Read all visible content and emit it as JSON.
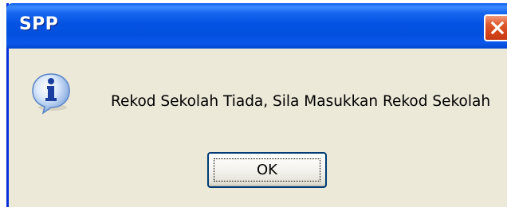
{
  "window": {
    "title": "SPP"
  },
  "dialog": {
    "icon": "information-icon",
    "message": "Rekod Sekolah Tiada, Sila Masukkan Rekod Sekolah",
    "ok_label": "OK"
  },
  "colors": {
    "titlebar": "#0553e3",
    "dialog_bg": "#ece9d8",
    "close_button": "#d2441a",
    "button_border": "#003c74"
  }
}
